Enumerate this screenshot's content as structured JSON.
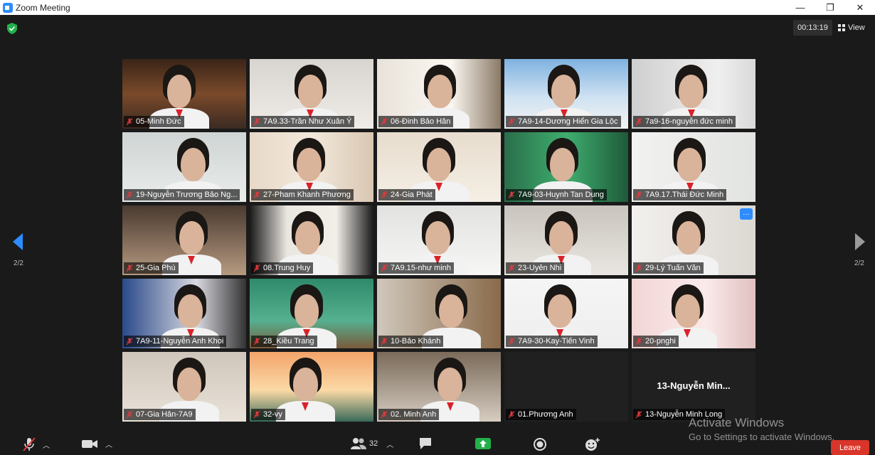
{
  "window": {
    "title": "Zoom Meeting",
    "minimize": "—",
    "restore": "❐",
    "close": "✕"
  },
  "header": {
    "timer": "00:13:19",
    "view_label": "View"
  },
  "pagination": {
    "left_page": "2/2",
    "right_page": "2/2"
  },
  "participants": [
    "05-Minh Đức",
    "7A9.33-Trần Như Xuân Ý",
    "06-Đinh Bảo Hân",
    "7A9-14-Dương Hiển Gia Lộc",
    "7a9-16-nguyễn đức minh",
    "19-Nguyễn Trương Bảo Ng...",
    "27-Pham Khanh Phương",
    "24-Gia Phát",
    "7A9-03-Huynh Tan Dung",
    "7A9.17.Thái Đức Minh",
    "25-Gia Phú",
    "08.Trung Huy",
    "7A9.15-như minh",
    "23-Uyên Nhi",
    "29-Lý Tuấn Văn",
    "7A9-11-Nguyễn Anh Khoi",
    "28_Kiều Trang",
    "10-Bảo Khánh",
    "7A9-30-Kay-Tiến Vinh",
    "20-pnghi",
    "07-Gia Hân-7A9",
    "32-vy",
    "02. Minh Anh",
    "01.Phương Anh",
    "13-Nguyễn Minh Long"
  ],
  "blank_tile": {
    "display_name": "13-Nguyễn  Min..."
  },
  "toolbar": {
    "participants_count": "32",
    "leave_label": "Leave"
  },
  "watermark": {
    "line1": "Activate Windows",
    "line2": "Go to Settings to activate Windows."
  },
  "colors": {
    "accent": "#2d8cff",
    "leave": "#d9352a",
    "background": "#1a1a1a"
  }
}
